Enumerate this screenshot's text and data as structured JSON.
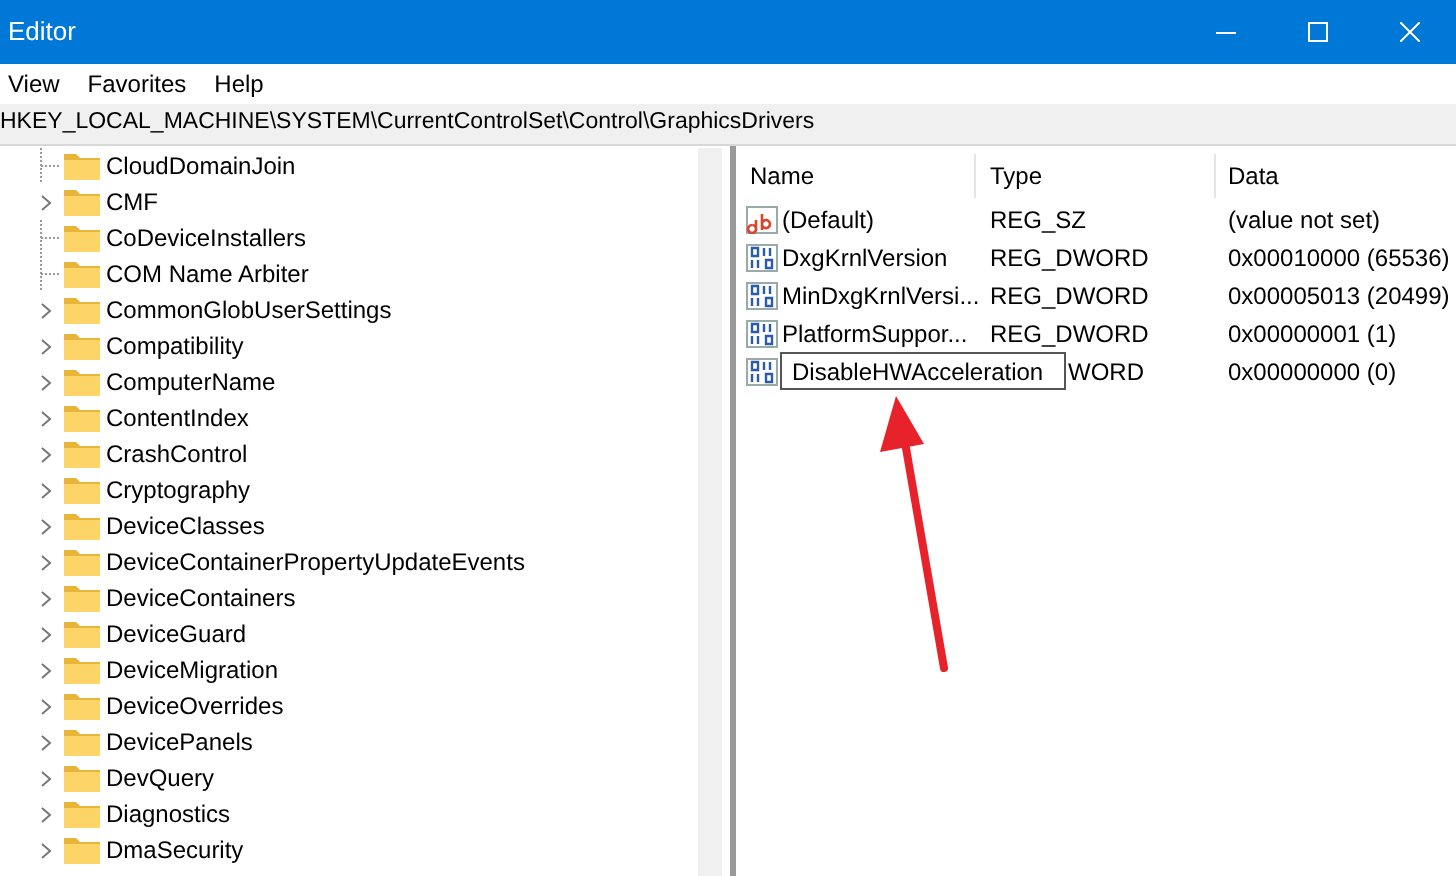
{
  "window": {
    "title": "Editor"
  },
  "menu": [
    "View",
    "Favorites",
    "Help"
  ],
  "address": "HKEY_LOCAL_MACHINE\\SYSTEM\\CurrentControlSet\\Control\\GraphicsDrivers",
  "tree": [
    {
      "label": "CloudDomainJoin",
      "expandable": false
    },
    {
      "label": "CMF",
      "expandable": true
    },
    {
      "label": "CoDeviceInstallers",
      "expandable": false
    },
    {
      "label": "COM Name Arbiter",
      "expandable": false
    },
    {
      "label": "CommonGlobUserSettings",
      "expandable": true
    },
    {
      "label": "Compatibility",
      "expandable": true
    },
    {
      "label": "ComputerName",
      "expandable": true
    },
    {
      "label": "ContentIndex",
      "expandable": true
    },
    {
      "label": "CrashControl",
      "expandable": true
    },
    {
      "label": "Cryptography",
      "expandable": true
    },
    {
      "label": "DeviceClasses",
      "expandable": true
    },
    {
      "label": "DeviceContainerPropertyUpdateEvents",
      "expandable": true
    },
    {
      "label": "DeviceContainers",
      "expandable": true
    },
    {
      "label": "DeviceGuard",
      "expandable": true
    },
    {
      "label": "DeviceMigration",
      "expandable": true
    },
    {
      "label": "DeviceOverrides",
      "expandable": true
    },
    {
      "label": "DevicePanels",
      "expandable": true
    },
    {
      "label": "DevQuery",
      "expandable": true
    },
    {
      "label": "Diagnostics",
      "expandable": true
    },
    {
      "label": "DmaSecurity",
      "expandable": true
    }
  ],
  "columns": [
    "Name",
    "Type",
    "Data"
  ],
  "values": [
    {
      "kind": "string",
      "name": "(Default)",
      "type": "REG_SZ",
      "data": "(value not set)",
      "editing": false
    },
    {
      "kind": "dword",
      "name": "DxgKrnlVersion",
      "type": "REG_DWORD",
      "data": "0x00010000 (65536)",
      "editing": false
    },
    {
      "kind": "dword",
      "name": "MinDxgKrnlVersi...",
      "type": "REG_DWORD",
      "data": "0x00005013 (20499)",
      "editing": false
    },
    {
      "kind": "dword",
      "name": "PlatformSuppor...",
      "type": "REG_DWORD",
      "data": "0x00000001 (1)",
      "editing": false
    },
    {
      "kind": "dword",
      "name": "DisableHWAcceleration",
      "type": "WORD",
      "data": "0x00000000 (0)",
      "editing": true
    }
  ]
}
